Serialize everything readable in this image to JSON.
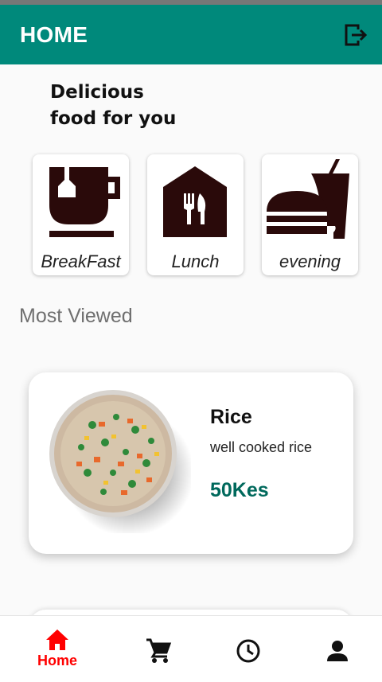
{
  "app_bar": {
    "title": "HOME",
    "logout_icon": "logout-icon",
    "color": "#00897b"
  },
  "headline": {
    "line1": "Delicious",
    "line2": "food for you"
  },
  "categories": [
    {
      "label": "BreakFast",
      "icon": "coffee-cup-icon"
    },
    {
      "label": "Lunch",
      "icon": "restaurant-house-icon"
    },
    {
      "label": "evening",
      "icon": "fastfood-icon"
    }
  ],
  "most_viewed": {
    "title": "Most Viewed",
    "items": [
      {
        "name": "Rice",
        "description": "well cooked rice",
        "price": "50Kes",
        "image": "fried-rice-bowl"
      }
    ]
  },
  "bottom_nav": {
    "items": [
      {
        "label": "Home",
        "icon": "home-icon",
        "active": true
      },
      {
        "label": "",
        "icon": "cart-icon",
        "active": false
      },
      {
        "label": "",
        "icon": "clock-icon",
        "active": false
      },
      {
        "label": "",
        "icon": "person-icon",
        "active": false
      }
    ],
    "active_color": "#ff0000"
  }
}
